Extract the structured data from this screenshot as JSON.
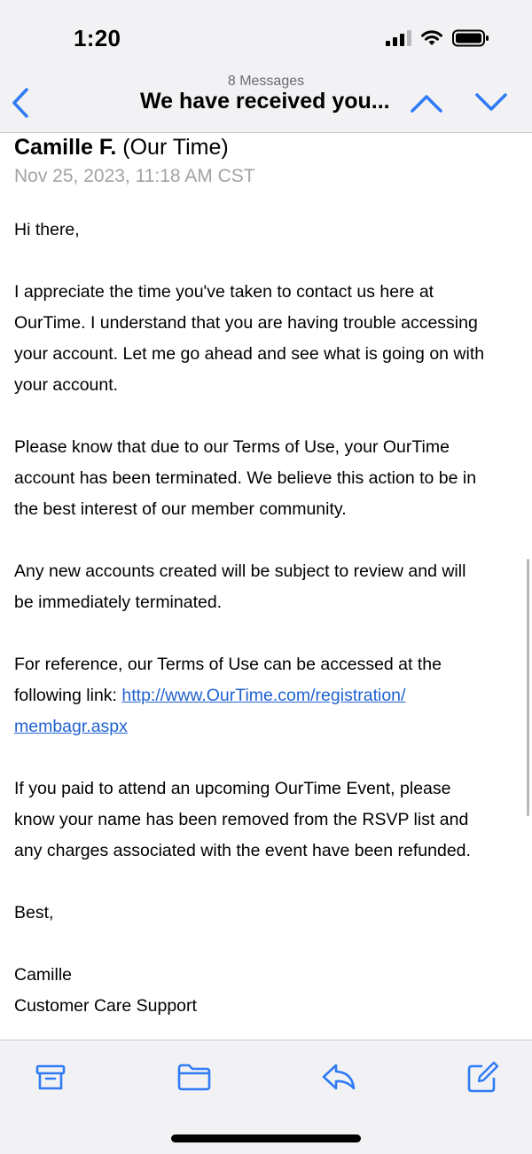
{
  "status_bar": {
    "time": "1:20"
  },
  "nav": {
    "message_count": "8 Messages",
    "subject": "We have received you..."
  },
  "email": {
    "sender_name": "Camille F.",
    "sender_org": "(Our Time)",
    "date": "Nov 25, 2023, 11:18 AM CST",
    "greeting": "Hi there,",
    "p1_l1": "I appreciate the time you've taken to contact us here at",
    "p1_l2": "OurTime. I understand that you are having trouble accessing",
    "p1_l3": "your account. Let me go ahead and see what is going on with",
    "p1_l4": "your account.",
    "p2_l1": "Please know that due to our Terms of Use, your OurTime",
    "p2_l2": "account has been terminated. We believe this action to be in",
    "p2_l3": "the best interest of our member community.",
    "p3_l1": "Any new accounts created will be subject to review and will",
    "p3_l2": "be immediately terminated.",
    "p4_l1": "For reference, our Terms of Use can be accessed at the",
    "p4_l2_prefix": "following link: ",
    "link_l1": "http://www.OurTime.com/registration/",
    "link_l2": "membagr.aspx",
    "p5_l1": "If you paid to attend an upcoming OurTime Event, please",
    "p5_l2": "know your name has been removed from the RSVP list and",
    "p5_l3": "any charges associated with the event have been refunded.",
    "signoff": "Best,",
    "sig_name": "Camille",
    "sig_title": "Customer Care Support"
  },
  "toolbar": {
    "icons": [
      "archive-icon",
      "folder-icon",
      "reply-icon",
      "compose-icon"
    ]
  },
  "colors": {
    "accent": "#1f62d1",
    "bar_bg": "#f2f2f5",
    "secondary_text": "#a2a2a7"
  }
}
